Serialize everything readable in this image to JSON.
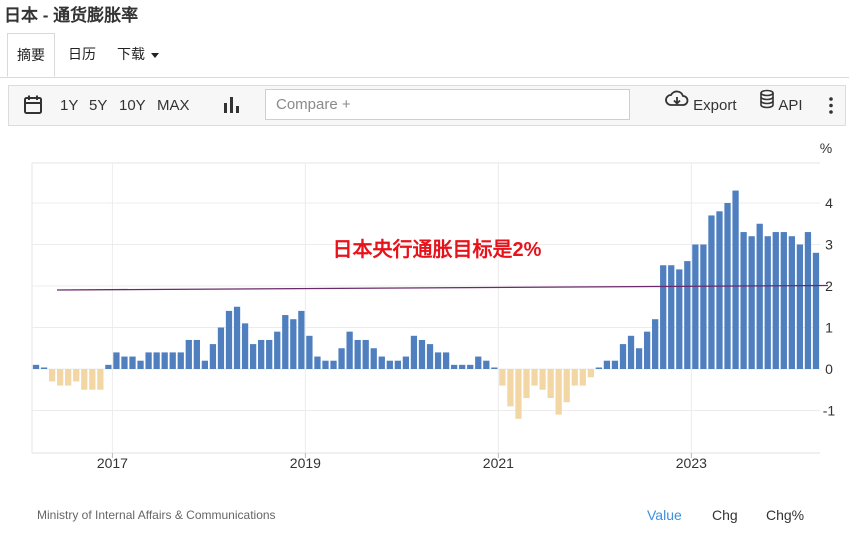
{
  "page_title": "日本 - 通货膨胀率",
  "tabs": [
    {
      "label": "摘要",
      "active": true
    },
    {
      "label": "日历",
      "active": false
    },
    {
      "label": "下载",
      "active": false
    }
  ],
  "toolbar": {
    "calendar_icon": "calendar-icon",
    "ranges": [
      "1Y",
      "5Y",
      "10Y",
      "MAX"
    ],
    "chart_type_icon": "bar-chart-icon",
    "compare_placeholder": "Compare +",
    "export_label": "Export",
    "api_label": "API",
    "more_icon": "more-vertical-icon"
  },
  "footer": {
    "source": "Ministry of Internal Affairs & Communications",
    "value_label": "Value",
    "chg_label": "Chg",
    "chgpct_label": "Chg%"
  },
  "chart_data": {
    "type": "bar",
    "unit_label": "%",
    "annotation": "日本央行通胀目标是2%",
    "target_line_value": 2,
    "x_ticks": [
      "2017",
      "2019",
      "2021",
      "2023"
    ],
    "y_ticks": [
      "4",
      "3",
      "2",
      "1",
      "0",
      "-1"
    ],
    "ylim": [
      -2,
      5
    ],
    "grid": true,
    "colors": {
      "positive": "#4f7fbf",
      "negative": "#f2d7a4",
      "target_line": "#6b2a6b",
      "annotation": "#e8121b"
    },
    "period": "monthly, 2016-03 to 2023-10",
    "values": [
      0.1,
      0.0,
      -0.3,
      -0.4,
      -0.4,
      -0.3,
      -0.5,
      -0.5,
      -0.5,
      0.1,
      0.4,
      0.3,
      0.3,
      0.2,
      0.4,
      0.4,
      0.4,
      0.4,
      0.4,
      0.7,
      0.7,
      0.2,
      0.6,
      1.0,
      1.4,
      1.5,
      1.1,
      0.6,
      0.7,
      0.7,
      0.9,
      1.3,
      1.2,
      1.4,
      0.8,
      0.3,
      0.2,
      0.2,
      0.5,
      0.9,
      0.7,
      0.7,
      0.5,
      0.3,
      0.2,
      0.2,
      0.3,
      0.8,
      0.7,
      0.6,
      0.4,
      0.4,
      0.1,
      0.1,
      0.1,
      0.3,
      0.2,
      0.0,
      -0.4,
      -0.9,
      -1.2,
      -0.7,
      -0.4,
      -0.5,
      -0.7,
      -1.1,
      -0.8,
      -0.4,
      -0.4,
      -0.2,
      0.0,
      0.2,
      0.2,
      0.6,
      0.8,
      0.5,
      0.9,
      1.2,
      2.5,
      2.5,
      2.4,
      2.6,
      3.0,
      3.0,
      3.7,
      3.8,
      4.0,
      4.3,
      3.3,
      3.2,
      3.5,
      3.2,
      3.3,
      3.3,
      3.2,
      3.0,
      3.3,
      2.8
    ]
  }
}
